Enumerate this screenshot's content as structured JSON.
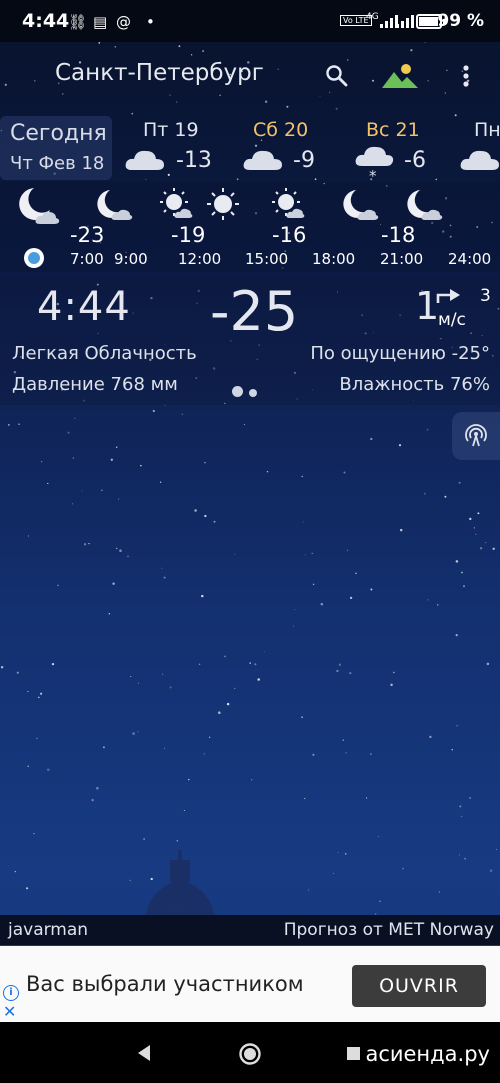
{
  "status_bar": {
    "time": "4:44",
    "battery_pct": "99 %",
    "net_label": "4G",
    "volte_label": "Vo LTE"
  },
  "header": {
    "city": "Санкт-Петербург",
    "icons": [
      "search-icon",
      "landscape-icon",
      "more-vert-icon"
    ]
  },
  "days": {
    "today_label": "Сегодня",
    "today_date": "Чт Фев 18",
    "items": [
      {
        "name": "Пт 19",
        "temp": "-13",
        "icon": "cloud-icon",
        "color": "#dfe4ee"
      },
      {
        "name": "Сб 20",
        "temp": "-9",
        "icon": "cloud-icon",
        "color": "#f2c26b"
      },
      {
        "name": "Вс 21",
        "temp": "-6",
        "icon": "snow-cloud-icon",
        "color": "#f2c26b"
      },
      {
        "name": "Пн",
        "temp": "",
        "icon": "cloud-icon",
        "color": "#dfe4ee"
      }
    ]
  },
  "hourly": {
    "temps": [
      "-23",
      "-19",
      "-16",
      "-18"
    ],
    "times": [
      "7:00",
      "9:00",
      "12:00",
      "15:00",
      "18:00",
      "21:00",
      "24:00"
    ],
    "icons": [
      "moon-cloud-icon",
      "moon-cloud-icon",
      "sun-cloud-icon",
      "sun-icon",
      "sun-cloud-icon",
      "moon-cloud-icon",
      "moon-cloud-icon"
    ]
  },
  "now": {
    "time": "4:44",
    "temp": "-25",
    "wind_speed": "1",
    "wind_gust": "3",
    "wind_unit": "м/с",
    "condition": "Легкая Облачность",
    "feels_like": "По ощущению -25°",
    "pressure": "Давление 768 мм",
    "humidity": "Влажность 76%"
  },
  "footer": {
    "author": "javarman",
    "provider": "Прогноз от MET Norway"
  },
  "ad": {
    "text": "Вас выбрали участником",
    "button": "OUVRIR"
  },
  "watermark": "асиенда.ру",
  "colors": {
    "weekend": "#f2c26b",
    "accent_dot": "#4a9be0"
  }
}
